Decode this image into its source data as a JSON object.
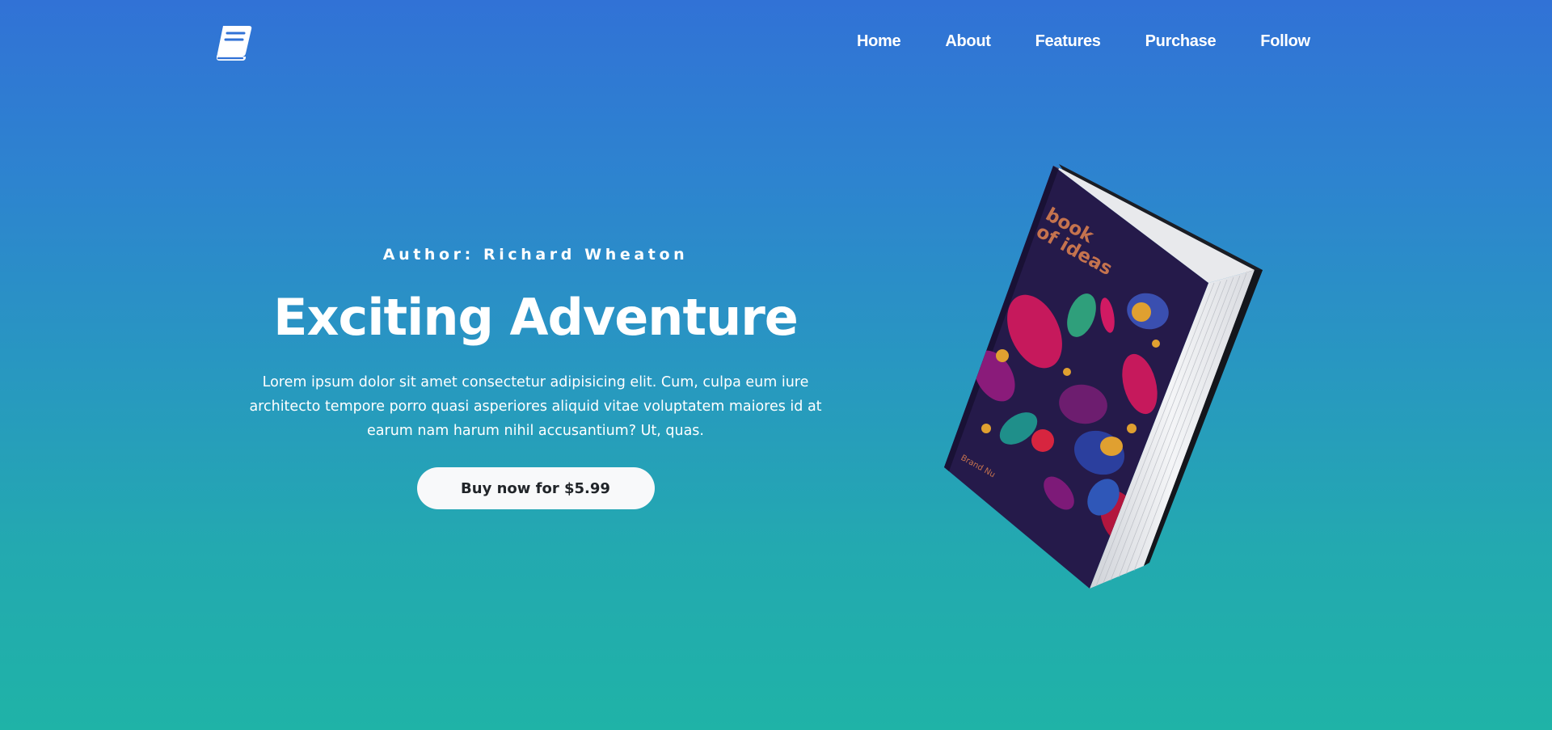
{
  "nav": {
    "logo_icon": "book-icon",
    "links": [
      "Home",
      "About",
      "Features",
      "Purchase",
      "Follow"
    ]
  },
  "hero": {
    "author": "Author: Richard Wheaton",
    "title": "Exciting Adventure",
    "description": "Lorem ipsum dolor sit amet consectetur adipisicing elit. Cum, culpa eum iure architecto tempore porro quasi asperiores aliquid vitae voluptatem maiores id at earum nam harum nihil accusantium? Ut, quas.",
    "button_label": "Buy now for $5.99"
  },
  "book": {
    "cover_title_line1": "book",
    "cover_title_line2": "of ideas",
    "cover_brand": "Brand Nu"
  },
  "colors": {
    "gradient_top": "#3172d6",
    "gradient_bottom": "#1fb3a7",
    "button_bg": "#f8f9fa",
    "button_text": "#212529",
    "cover_bg": "#251a4a",
    "cover_title": "#c5734e"
  }
}
